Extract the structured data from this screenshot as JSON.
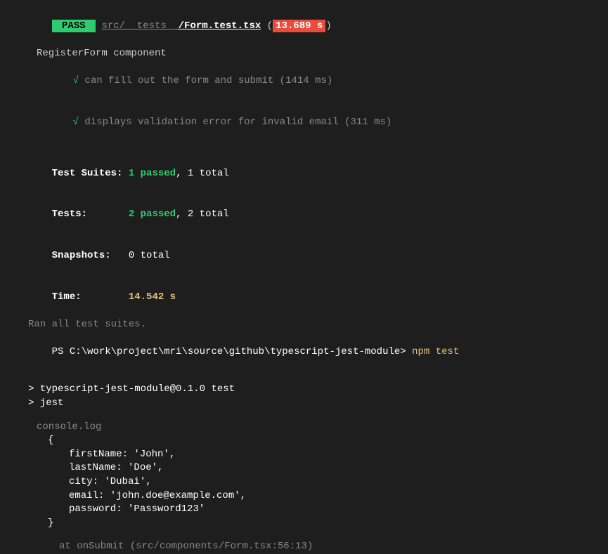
{
  "header": {
    "badge": " PASS ",
    "path_prefix": "src/__tests__",
    "path_file": "/Form.test.tsx",
    "duration": "13.689 s"
  },
  "suite": {
    "name": "RegisterForm component",
    "tests": [
      {
        "check": "√",
        "label": "can fill out the form and submit",
        "ms": "(1414 ms)"
      },
      {
        "check": "√",
        "label": "displays validation error for invalid email",
        "ms": "(311 ms)"
      }
    ]
  },
  "summary": {
    "suites_label": "Test Suites:",
    "suites_passed": "1 passed",
    "suites_total": ", 1 total",
    "tests_label": "Tests:",
    "tests_passed": "2 passed",
    "tests_total": ", 2 total",
    "snapshots_label": "Snapshots:",
    "snapshots_val": "0 total",
    "time_label": "Time:",
    "time_val": "14.542 s",
    "ran": "Ran all test suites."
  },
  "prompt": {
    "ps": "PS C:\\work\\project\\mri\\source\\github\\typescript-jest-module> ",
    "cmd": "npm test"
  },
  "npm": {
    "line1": "> typescript-jest-module@0.1.0 test",
    "line2": "> jest"
  },
  "log": {
    "header": "console.log",
    "open": "{",
    "props": [
      "firstName: 'John',",
      "lastName: 'Doe',",
      "city: 'Dubai',",
      "email: 'john.doe@example.com',",
      "password: 'Password123'"
    ],
    "close": "}",
    "at": "at onSubmit (src/components/Form.tsx:56:13)"
  }
}
